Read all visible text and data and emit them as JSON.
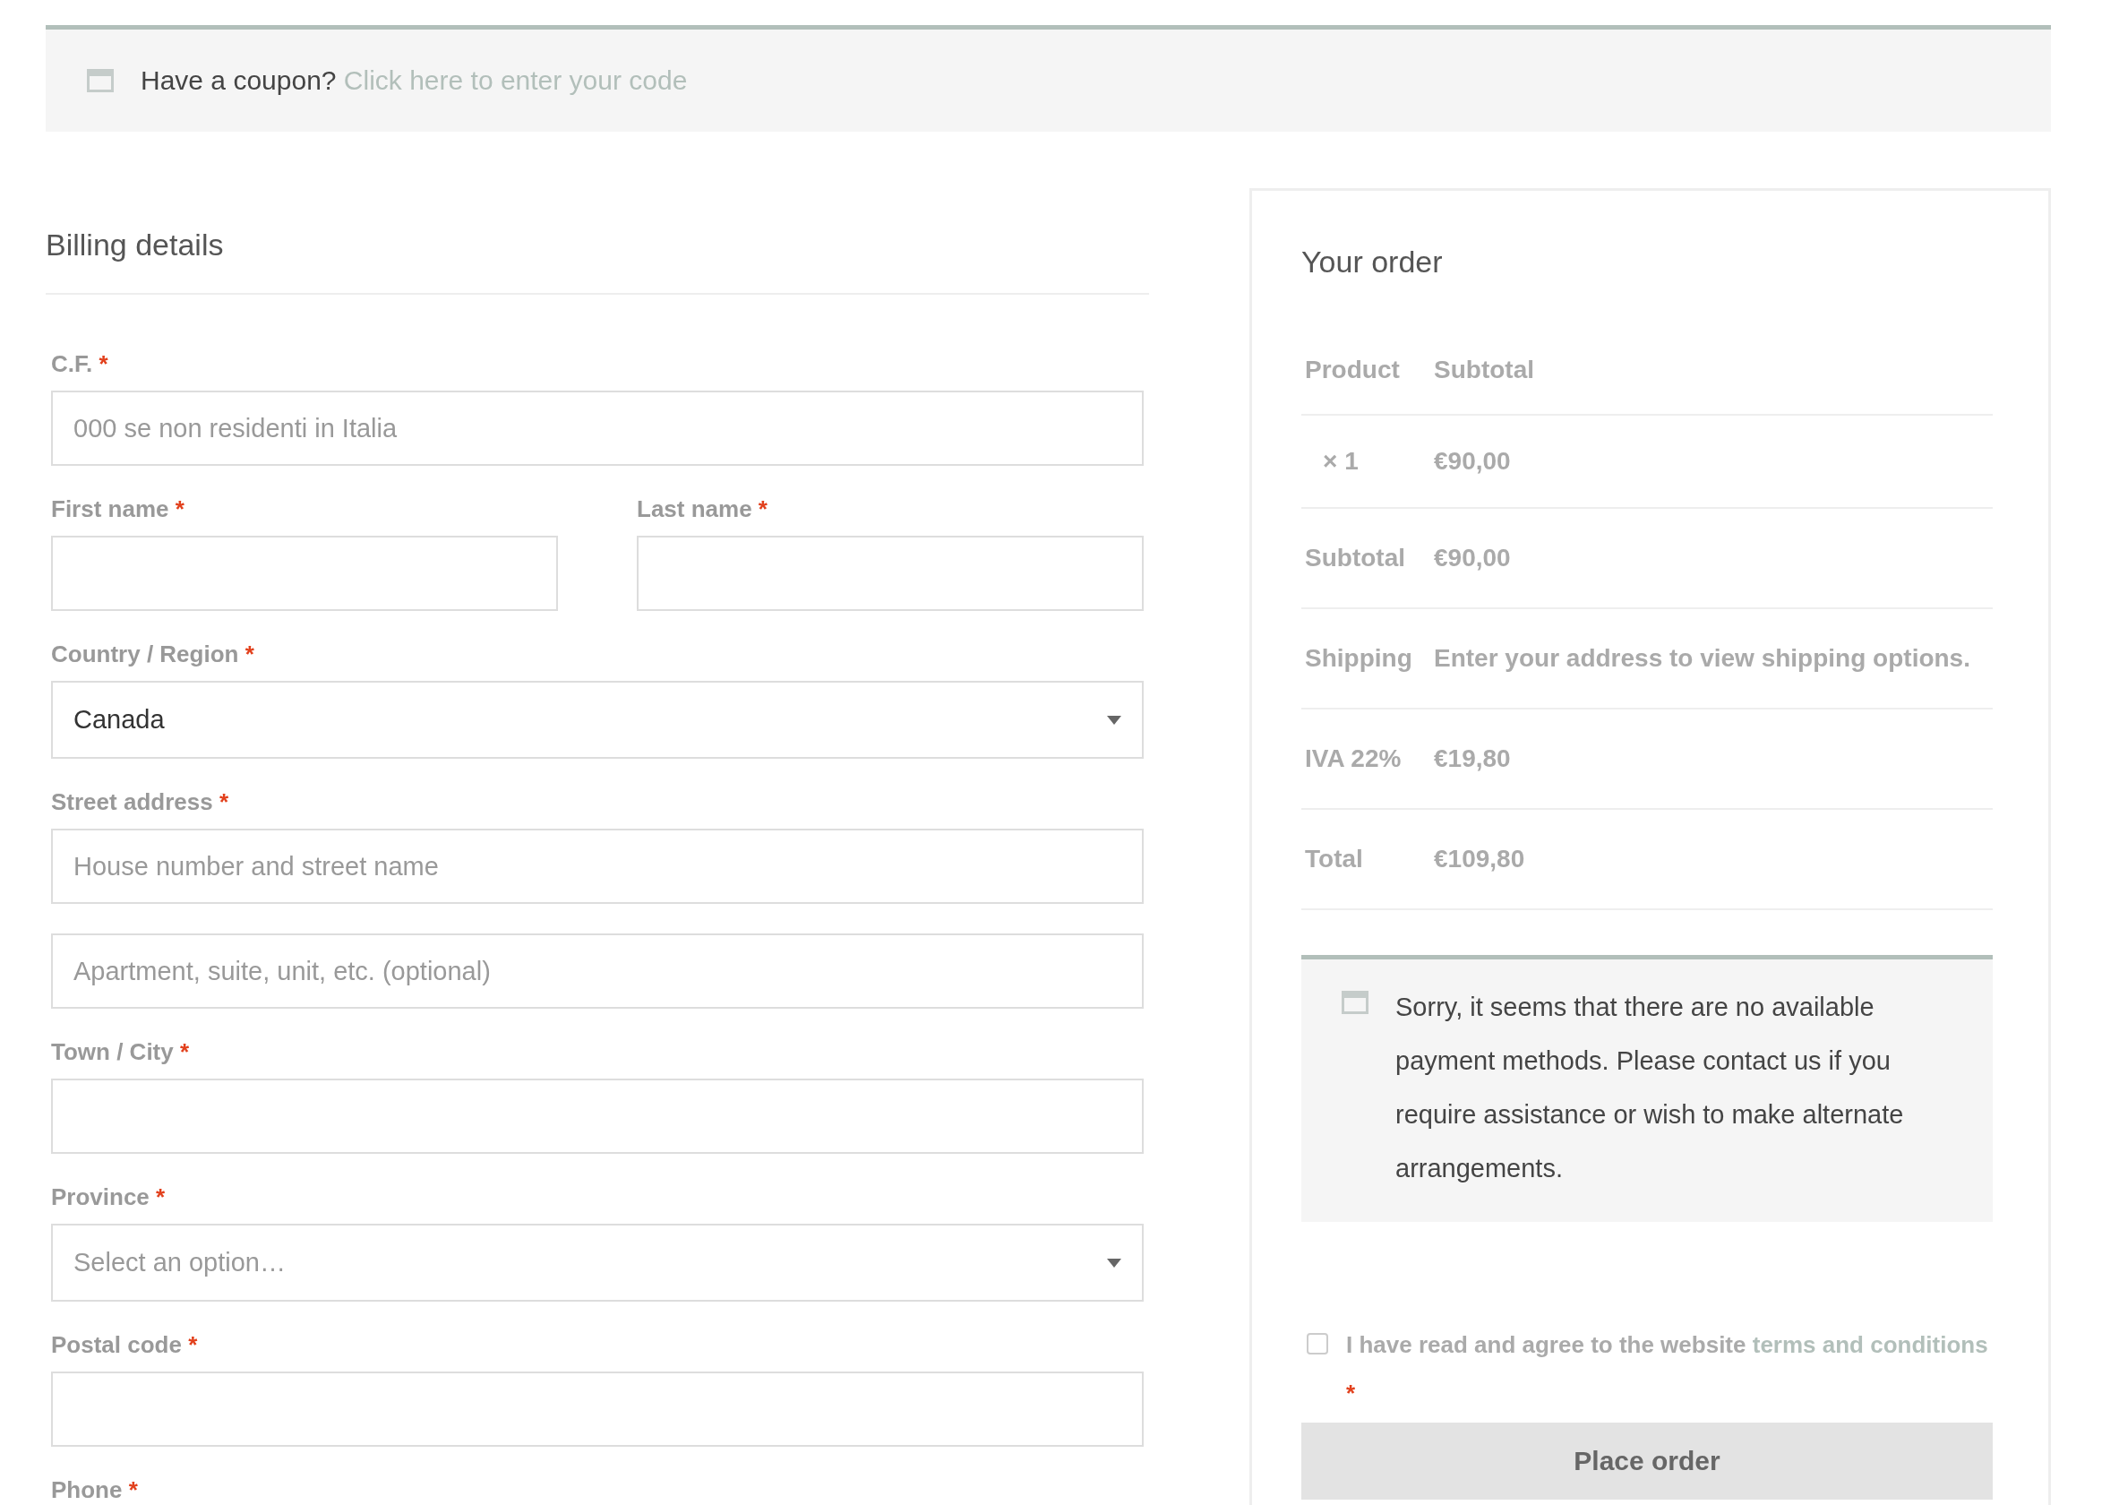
{
  "coupon_notice": {
    "text": "Have a coupon?",
    "link": "Click here to enter your code"
  },
  "billing": {
    "title": "Billing details",
    "fields": [
      {
        "kind": "text",
        "label": "C.F.",
        "required_mark": "*",
        "placeholder": "000 se non residenti in Italia"
      },
      {
        "kind": "half",
        "label": "First name",
        "required_mark": "*"
      },
      {
        "kind": "half",
        "label": "Last name",
        "required_mark": "*"
      },
      {
        "kind": "select",
        "label": "Country / Region",
        "required_mark": "*",
        "value": "Canada"
      },
      {
        "kind": "text",
        "label": "Street address",
        "required_mark": "*",
        "placeholder": "House number and street name"
      },
      {
        "kind": "text",
        "placeholder": "Apartment, suite, unit, etc. (optional)"
      },
      {
        "kind": "text",
        "label": "Town / City",
        "required_mark": "*"
      },
      {
        "kind": "select",
        "label": "Province",
        "required_mark": "*",
        "placeholder": "Select an option…"
      },
      {
        "kind": "text",
        "label": "Postal code",
        "required_mark": "*"
      },
      {
        "kind": "text",
        "label": "Phone",
        "required_mark": "*"
      }
    ]
  },
  "order": {
    "title": "Your order",
    "columns": [
      "Product",
      "Subtotal"
    ],
    "rows": [
      {
        "kind": "item",
        "label": "× 1",
        "value": "€90,00"
      },
      {
        "kind": "total",
        "label": "Subtotal",
        "value": "€90,00"
      },
      {
        "kind": "total",
        "label": "Shipping",
        "value": "Enter your address to view shipping options."
      },
      {
        "kind": "total",
        "label": "IVA 22%",
        "value": "€19,80"
      },
      {
        "kind": "total",
        "label": "Total",
        "value": "€109,80"
      }
    ],
    "payment_notice": "Sorry, it seems that there are no available payment methods. Please contact us if you require assistance or wish to make alternate arrangements.",
    "terms": {
      "checked": false,
      "text": "I have read and agree to the website",
      "link": "terms and conditions",
      "required_mark": "*"
    },
    "button": "Place order"
  }
}
